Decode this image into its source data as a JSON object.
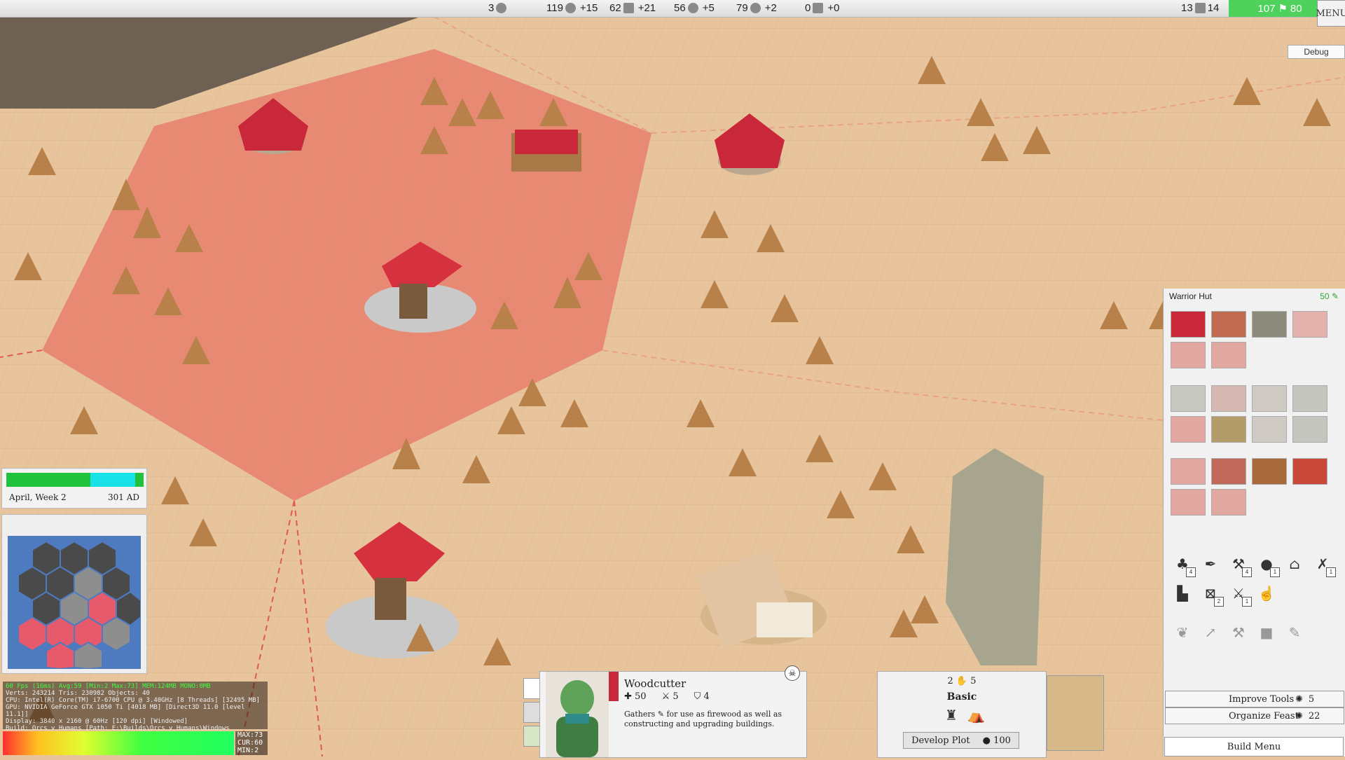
{
  "topbar": {
    "resources": [
      {
        "name": "gold",
        "icon": "coin-icon",
        "amount": "3",
        "delta": ""
      },
      {
        "name": "stone",
        "icon": "stone-icon",
        "amount": "119",
        "delta": "+15"
      },
      {
        "name": "wood",
        "icon": "wood-icon",
        "amount": "62",
        "delta": "+21"
      },
      {
        "name": "ore",
        "icon": "ore-icon",
        "amount": "56",
        "delta": "+5"
      },
      {
        "name": "food",
        "icon": "food-icon",
        "amount": "79",
        "delta": "+2"
      },
      {
        "name": "beer",
        "icon": "beer-icon",
        "amount": "0",
        "delta": "+0"
      }
    ],
    "housing": {
      "used": "13",
      "capacity": "14"
    },
    "population": {
      "current": "107",
      "max": "80"
    },
    "menu_label": "MENU",
    "debug_label": "Debug"
  },
  "calendar": {
    "date": "April, Week 2",
    "year": "301 AD",
    "progress": 0.73
  },
  "stats": {
    "line1": "60 Fps (16ms)  Avg:59 [Min:2 Max:73]   MEM:124MB MONO:0MB",
    "line2": "Verts: 243214 Tris: 230982 Objects: 40",
    "line3": "CPU: Intel(R) Core(TM) i7-6700 CPU @ 3.40GHz [8 Threads] [32495 MB]",
    "line4": "GPU: NVIDIA GeForce GTX 1050 Ti [4018 MB] [Direct3D 11.0 [level 11.1]]",
    "line5": "Display: 3840 x 2160 @ 60Hz [120 dpi] [Windowed]",
    "line6": "Build: Orcs v Humans [Path: E:\\Builds\\Orcs v Humans\\Windows Standalone\\]",
    "max": "MAX:73",
    "cur": "CUR:60",
    "min": "MIN:2"
  },
  "build_panel": {
    "title": "Warrior Hut",
    "cost": "50",
    "tools": [
      {
        "icon": "stump-icon",
        "count": "4"
      },
      {
        "icon": "feather-icon",
        "count": ""
      },
      {
        "icon": "axe-icon",
        "count": "4"
      },
      {
        "icon": "mortar-icon",
        "count": "1"
      },
      {
        "icon": "bucket-icon",
        "count": ""
      },
      {
        "icon": "crossed-tools-icon",
        "count": "1"
      },
      {
        "icon": "boot-icon",
        "count": ""
      },
      {
        "icon": "bow-icon",
        "count": "2"
      },
      {
        "icon": "pickaxe-icon",
        "count": "1"
      },
      {
        "icon": "hand-icon",
        "count": ""
      },
      {
        "icon": "leaf-icon",
        "count": ""
      },
      {
        "icon": "shovel-icon",
        "count": ""
      },
      {
        "icon": "hammer-icon",
        "count": ""
      },
      {
        "icon": "block-icon",
        "count": ""
      },
      {
        "icon": "wrench-icon",
        "count": ""
      }
    ],
    "improve_tools": {
      "label": "Improve Tools",
      "cost": "5"
    },
    "organize_feast": {
      "label": "Organize Feast",
      "cost": "22"
    },
    "build_menu": "Build Menu"
  },
  "unit": {
    "name": "Woodcutter",
    "health": "50",
    "attack": "5",
    "armor": "4",
    "desc_prefix": "Gathers",
    "desc_suffix": "for use as firewood as well as constructing and upgrading buildings."
  },
  "plot": {
    "workers": "2",
    "capacity": "5",
    "type": "Basic",
    "develop_label": "Develop Plot",
    "develop_cost": "100"
  },
  "colors": {
    "territory": "#e8806c",
    "ground": "#e7c49b",
    "accent": "#4fd25c",
    "flag": "#c8283a"
  }
}
